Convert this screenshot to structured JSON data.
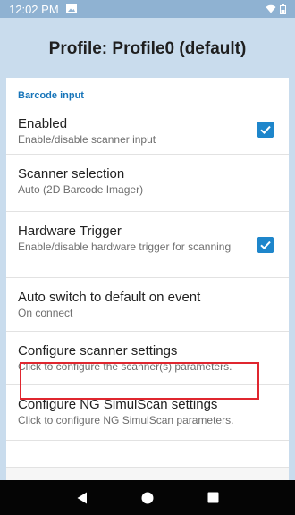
{
  "status": {
    "time": "12:02 PM",
    "icons": [
      "image-notification-icon",
      "wifi-icon",
      "battery-icon"
    ]
  },
  "app_bar": {
    "title": "Profile: Profile0 (default)"
  },
  "section": {
    "title": "Barcode input"
  },
  "preferences": [
    {
      "title": "Enabled",
      "summary": "Enable/disable scanner input",
      "checked": true
    },
    {
      "title": "Scanner selection",
      "summary": "Auto (2D Barcode Imager)"
    },
    {
      "title": "Hardware Trigger",
      "summary": "Enable/disable hardware trigger for scanning",
      "checked": true
    },
    {
      "title": "Auto switch to default on event",
      "summary": "On connect"
    },
    {
      "title": "Configure scanner settings",
      "summary": "Click to configure the scanner(s) parameters.",
      "highlighted": true
    },
    {
      "title": "Configure NG SimulScan settings",
      "summary": "Click to configure NG SimulScan parameters."
    }
  ],
  "navigation": {
    "buttons": [
      "back-icon",
      "home-icon",
      "recents-icon"
    ]
  },
  "colors": {
    "app_bar": "#c9dced",
    "status_bar": "#8fb2d2",
    "accent": "#1674b9",
    "checkbox": "#1e86cb",
    "highlight": "#e0262f",
    "nav_bar": "#050505"
  }
}
